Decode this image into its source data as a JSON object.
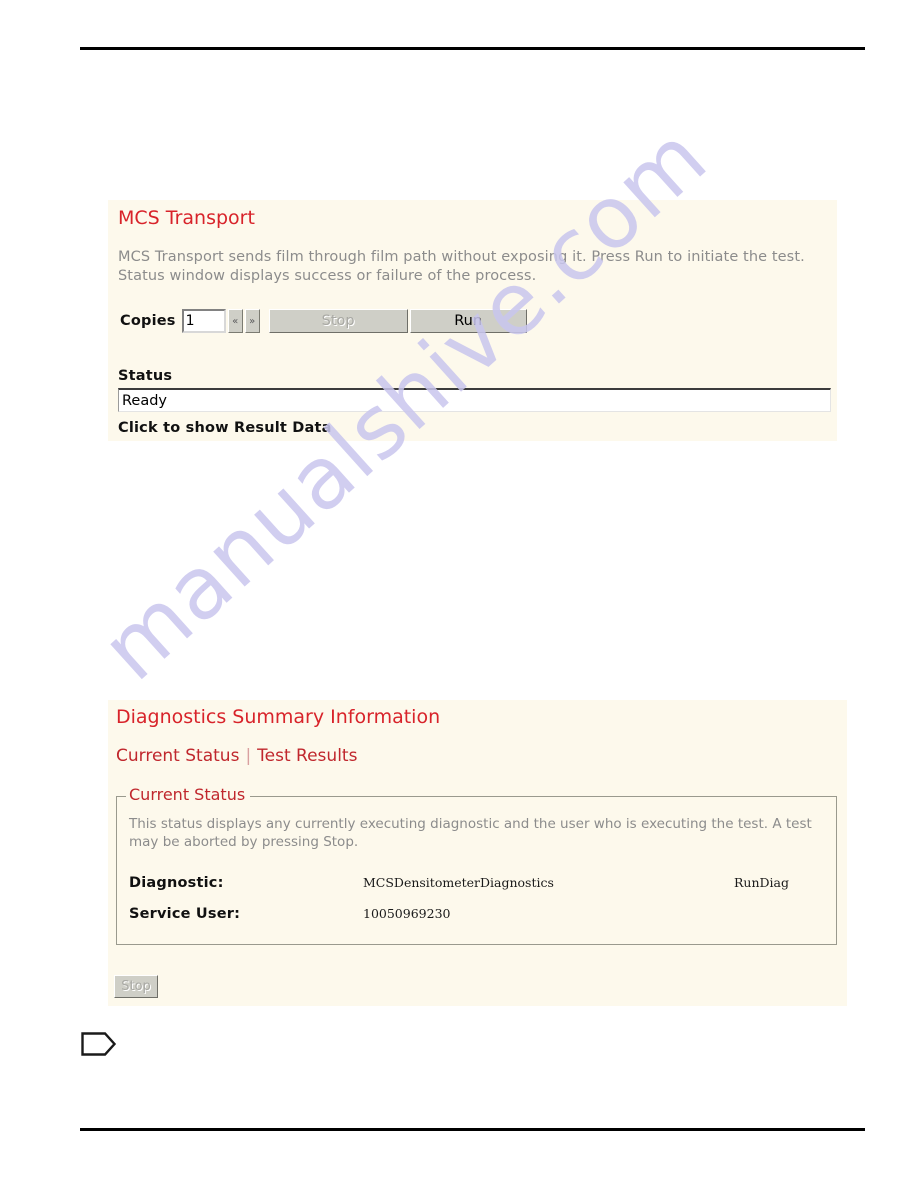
{
  "watermark": {
    "text": "manualshive.com"
  },
  "colors": {
    "panel_background": "#fdf9ec",
    "title_red": "#d8232a",
    "link_red": "#c0272d",
    "body_gray": "#8c8c8c",
    "button_face": "#cfcfc7",
    "rule_black": "#000000",
    "watermark_lavender": "#c9c6ee"
  },
  "mcs_transport_panel": {
    "title": "MCS Transport",
    "description": "MCS Transport sends film through film path without exposing it. Press Run to initiate the test. Status window displays success or failure of the process.",
    "copies": {
      "label": "Copies",
      "value": "1",
      "decrement_icon": "«",
      "increment_icon": "»"
    },
    "buttons": {
      "stop": "Stop",
      "run": "Run"
    },
    "status": {
      "label": "Status",
      "value": "Ready"
    },
    "result_link": "Click to show Result Data"
  },
  "diagnostics_panel": {
    "title": "Diagnostics Summary Information",
    "tabs": [
      {
        "label": "Current Status"
      },
      {
        "label": "Test Results"
      }
    ],
    "tab_separator": "|",
    "fieldset": {
      "legend": "Current Status",
      "description": "This status displays any currently executing diagnostic and the user who is executing the test. A test may be aborted by pressing Stop.",
      "rows": [
        {
          "key": "Diagnostic:",
          "value": "MCSDensitometerDiagnostics",
          "extra": "RunDiag"
        },
        {
          "key": "Service User:",
          "value": "10050969230",
          "extra": ""
        }
      ]
    },
    "stop_button": "Stop"
  }
}
